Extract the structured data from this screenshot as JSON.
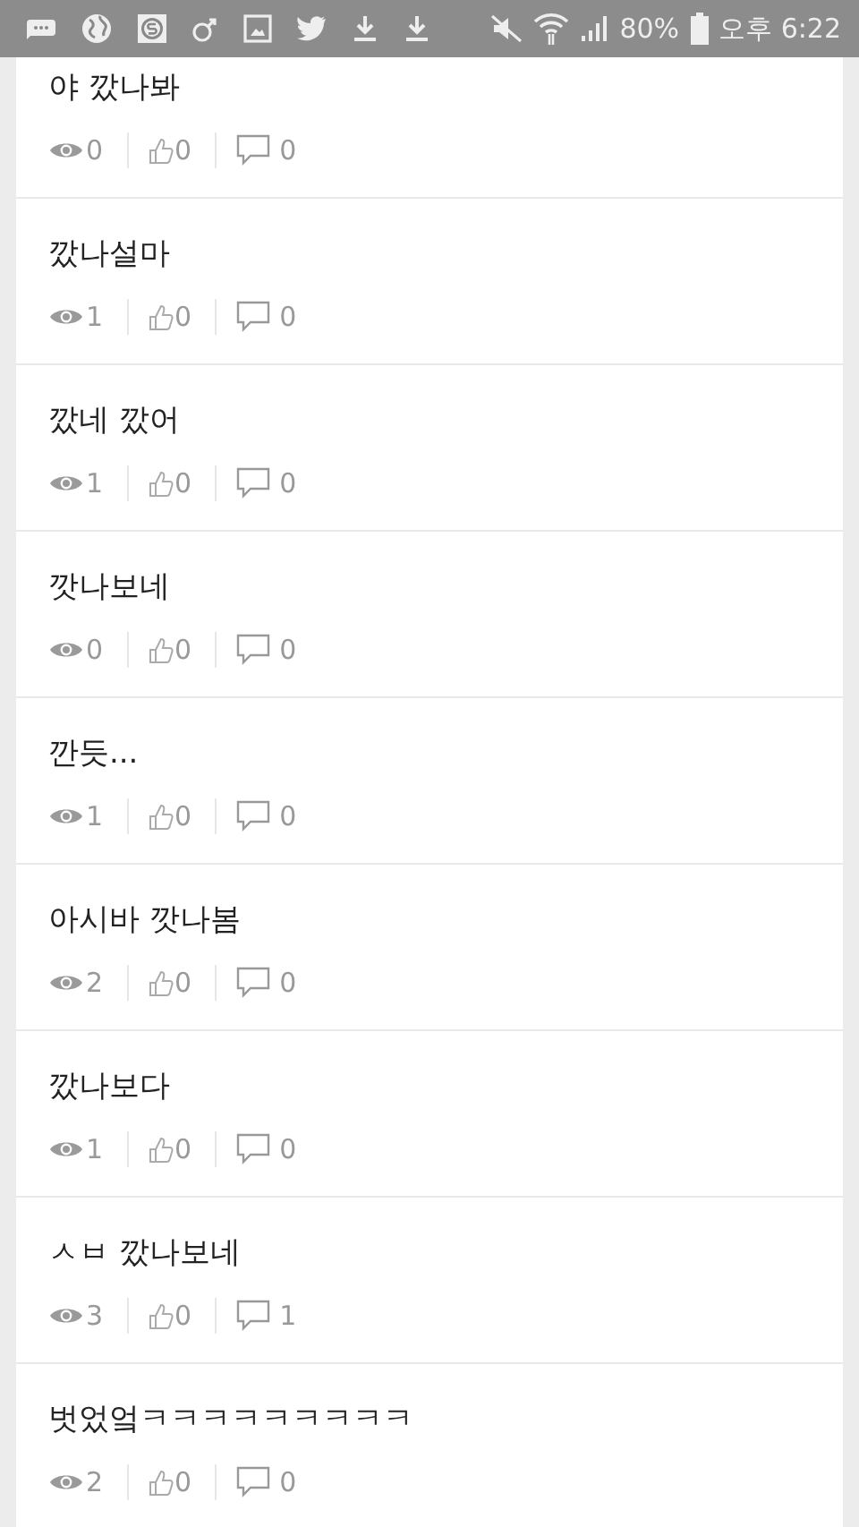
{
  "status_bar": {
    "battery": "80%",
    "time": "오후 6:22"
  },
  "posts": [
    {
      "title": "야 깠나봐",
      "views": "0",
      "likes": "0",
      "comments": "0"
    },
    {
      "title": "깠나설마",
      "views": "1",
      "likes": "0",
      "comments": "0"
    },
    {
      "title": "깠네 깠어",
      "views": "1",
      "likes": "0",
      "comments": "0"
    },
    {
      "title": "깟나보네",
      "views": "0",
      "likes": "0",
      "comments": "0"
    },
    {
      "title": "깐듯...",
      "views": "1",
      "likes": "0",
      "comments": "0"
    },
    {
      "title": "아시바 깟나봄",
      "views": "2",
      "likes": "0",
      "comments": "0"
    },
    {
      "title": "깠나보다",
      "views": "1",
      "likes": "0",
      "comments": "0"
    },
    {
      "title": "ㅅㅂ 깠나보네",
      "views": "3",
      "likes": "0",
      "comments": "1"
    },
    {
      "title": "벗었엌ㅋㅋㅋㅋㅋㅋㅋㅋㅋ",
      "views": "2",
      "likes": "0",
      "comments": "0"
    }
  ]
}
